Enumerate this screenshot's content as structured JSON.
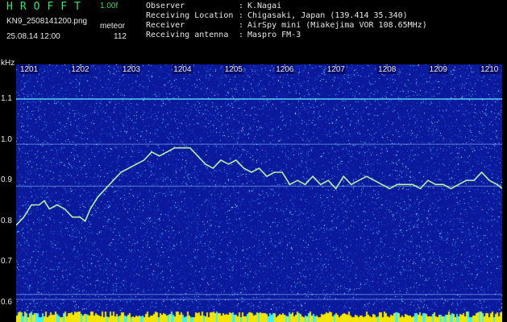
{
  "header": {
    "app_title": "HROFFT",
    "version": "1.00f",
    "filename": "KN9_2508141200.png",
    "datetime": "25.08.14 12:00",
    "meteor_label": "meteor",
    "meteor_count": "112",
    "info": [
      {
        "key": "Observer",
        "sep": ":",
        "value": "K.Nagai"
      },
      {
        "key": "Receiving Location",
        "sep": ":",
        "value": "Chigasaki, Japan (139.414 35.340)"
      },
      {
        "key": "Receiver",
        "sep": ":",
        "value": "AirSpy mini (Miakejima VOR 108.65MHz)"
      },
      {
        "key": "Receiving antenna",
        "sep": ":",
        "value": "Maspro FM-3"
      }
    ]
  },
  "colors": {
    "background": "#000000",
    "plot_background": "#0b1a9c",
    "noise_speckle": "#6fd4ff",
    "trace": "#b8f0a0",
    "title_green": "#2ee66b",
    "bottom_bar": "#f2e600",
    "bottom_bar_alt": "#3cf0ff"
  },
  "chart_data": {
    "type": "line",
    "title": "",
    "xlabel": "",
    "ylabel": "kHz",
    "x_ticks": [
      "1201",
      "1202",
      "1203",
      "1204",
      "1205",
      "1206",
      "1207",
      "1208",
      "1209",
      "1210"
    ],
    "y_ticks": [
      "1.1",
      "1.0",
      "0.9",
      "0.8",
      "0.7",
      "0.6"
    ],
    "xlim": [
      1200.75,
      1210.25
    ],
    "ylim": [
      0.58,
      1.185
    ],
    "grid": false,
    "horizontal_lines_khz": [
      1.1,
      0.989,
      0.886,
      0.62,
      0.608
    ],
    "series": [
      {
        "x": [
          1200.75,
          1200.9,
          1201.05,
          1201.2,
          1201.3,
          1201.4,
          1201.55,
          1201.7,
          1201.85,
          1202.0,
          1202.1,
          1202.2,
          1202.35,
          1202.5,
          1202.65,
          1202.8,
          1202.95,
          1203.1,
          1203.25,
          1203.4,
          1203.55,
          1203.7,
          1203.85,
          1204.0,
          1204.15,
          1204.3,
          1204.45,
          1204.6,
          1204.75,
          1204.9,
          1205.05,
          1205.2,
          1205.35,
          1205.5,
          1205.65,
          1205.8,
          1205.95,
          1206.1,
          1206.25,
          1206.4,
          1206.55,
          1206.7,
          1206.85,
          1207.0,
          1207.15,
          1207.3,
          1207.45,
          1207.6,
          1207.75,
          1207.9,
          1208.05,
          1208.2,
          1208.35,
          1208.5,
          1208.65,
          1208.8,
          1208.95,
          1209.1,
          1209.25,
          1209.4,
          1209.55,
          1209.7,
          1209.85,
          1210.0,
          1210.15,
          1210.25
        ],
        "y": [
          0.79,
          0.81,
          0.84,
          0.84,
          0.85,
          0.83,
          0.84,
          0.83,
          0.81,
          0.81,
          0.8,
          0.83,
          0.86,
          0.88,
          0.9,
          0.92,
          0.93,
          0.94,
          0.95,
          0.97,
          0.96,
          0.97,
          0.98,
          0.98,
          0.98,
          0.96,
          0.94,
          0.93,
          0.95,
          0.94,
          0.95,
          0.93,
          0.92,
          0.93,
          0.91,
          0.92,
          0.92,
          0.89,
          0.9,
          0.89,
          0.91,
          0.89,
          0.9,
          0.88,
          0.91,
          0.89,
          0.9,
          0.91,
          0.9,
          0.89,
          0.88,
          0.89,
          0.89,
          0.89,
          0.88,
          0.9,
          0.89,
          0.89,
          0.88,
          0.89,
          0.9,
          0.9,
          0.92,
          0.9,
          0.89,
          0.88
        ]
      }
    ]
  }
}
